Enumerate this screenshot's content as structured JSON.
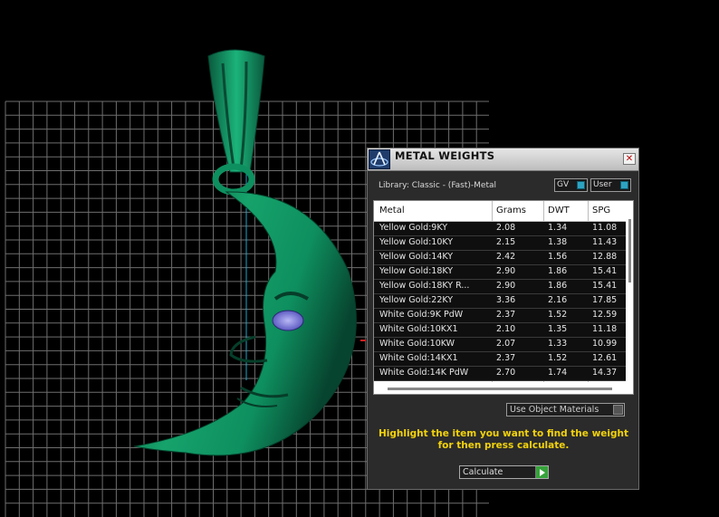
{
  "panel": {
    "title": "METAL WEIGHTS",
    "close_glyph": "✕",
    "library_label": "Library: Classic - (Fast)-Metal",
    "gv_toggle": "GV",
    "user_toggle": "User",
    "table": {
      "headers": [
        "Metal",
        "Grams",
        "DWT",
        "SPG"
      ],
      "rows": [
        [
          "Yellow Gold:9KY",
          "2.08",
          "1.34",
          "11.08"
        ],
        [
          "Yellow Gold:10KY",
          "2.15",
          "1.38",
          "11.43"
        ],
        [
          "Yellow Gold:14KY",
          "2.42",
          "1.56",
          "12.88"
        ],
        [
          "Yellow Gold:18KY",
          "2.90",
          "1.86",
          "15.41"
        ],
        [
          "Yellow Gold:18KY R...",
          "2.90",
          "1.86",
          "15.41"
        ],
        [
          "Yellow Gold:22KY",
          "3.36",
          "2.16",
          "17.85"
        ],
        [
          "White Gold:9K PdW",
          "2.37",
          "1.52",
          "12.59"
        ],
        [
          "White Gold:10KX1",
          "2.10",
          "1.35",
          "11.18"
        ],
        [
          "White Gold:10KW",
          "2.07",
          "1.33",
          "10.99"
        ],
        [
          "White Gold:14KX1",
          "2.37",
          "1.52",
          "12.61"
        ],
        [
          "White Gold:14K PdW",
          "2.70",
          "1.74",
          "14.37"
        ]
      ]
    },
    "use_object_materials": "Use Object Materials",
    "hint": "Highlight the item you want to find the weight for then press calculate.",
    "calculate_label": "Calculate"
  },
  "colors": {
    "model_green": "#0e8f5f",
    "hint_yellow": "#f2d20a",
    "grid_line": "#6e6e6e"
  },
  "icons": {
    "logo": "app-logo-icon",
    "close": "close-icon",
    "calculate": "play-icon"
  }
}
